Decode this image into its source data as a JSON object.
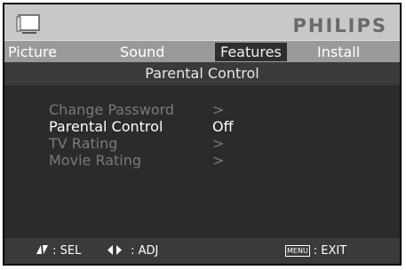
{
  "header": {
    "brand": "PHILIPS",
    "icon": "tv-icon"
  },
  "tabs": [
    {
      "label": "Picture",
      "active": false
    },
    {
      "label": "Sound",
      "active": false
    },
    {
      "label": "Features",
      "active": true
    },
    {
      "label": "Install",
      "active": false
    }
  ],
  "submenu_title": "Parental Control",
  "items": [
    {
      "label": "Change Password",
      "value": ">"
    },
    {
      "label": "Parental Control",
      "value": "Off"
    },
    {
      "label": "TV Rating",
      "value": ">"
    },
    {
      "label": "Movie Rating",
      "value": ">"
    }
  ],
  "footer": {
    "sel_icon": "up-down-arrows-icon",
    "sel_label": ": SEL",
    "adj_icon": "left-right-arrows-icon",
    "adj_label": ": ADJ",
    "menu_key": "MENU",
    "exit_label": ": EXIT"
  }
}
